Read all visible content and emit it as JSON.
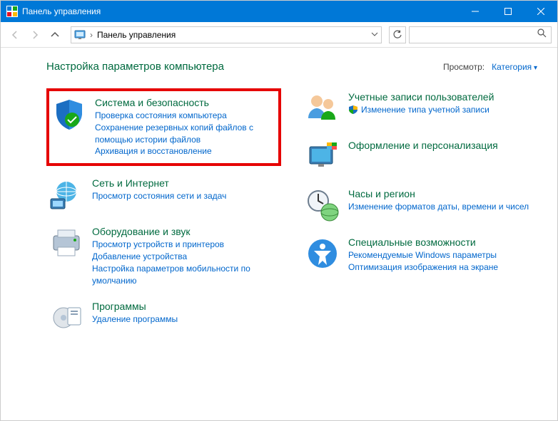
{
  "window": {
    "title": "Панель управления"
  },
  "breadcrumb": {
    "location": "Панель управления"
  },
  "page": {
    "title": "Настройка параметров компьютера",
    "view_label": "Просмотр:",
    "view_value": "Категория"
  },
  "categories": {
    "system": {
      "title": "Система и безопасность",
      "links": [
        "Проверка состояния компьютера",
        "Сохранение резервных копий файлов с помощью истории файлов",
        "Архивация и восстановление"
      ]
    },
    "network": {
      "title": "Сеть и Интернет",
      "links": [
        "Просмотр состояния сети и задач"
      ]
    },
    "hardware": {
      "title": "Оборудование и звук",
      "links": [
        "Просмотр устройств и принтеров",
        "Добавление устройства",
        "Настройка параметров мобильности по умолчанию"
      ]
    },
    "programs": {
      "title": "Программы",
      "links": [
        "Удаление программы"
      ]
    },
    "accounts": {
      "title": "Учетные записи пользователей",
      "links": [
        "Изменение типа учетной записи"
      ]
    },
    "personalization": {
      "title": "Оформление и персонализация"
    },
    "clock": {
      "title": "Часы и регион",
      "links": [
        "Изменение форматов даты, времени и чисел"
      ]
    },
    "ease": {
      "title": "Специальные возможности",
      "links": [
        "Рекомендуемые Windows параметры",
        "Оптимизация изображения на экране"
      ]
    }
  }
}
